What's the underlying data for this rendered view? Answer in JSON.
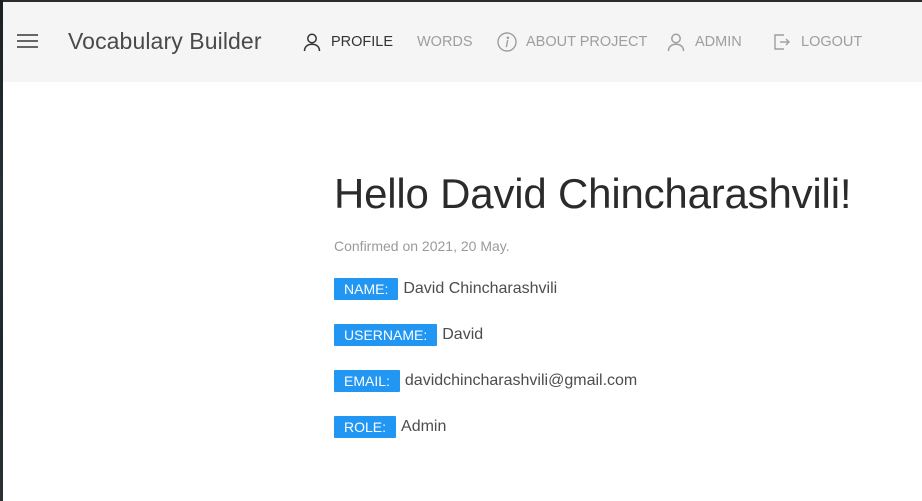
{
  "app": {
    "title": "Vocabulary Builder"
  },
  "nav": {
    "items": [
      {
        "label": "PROFILE",
        "icon": "user-icon",
        "active": true
      },
      {
        "label": "WORDS",
        "icon": "",
        "active": false
      },
      {
        "label": "ABOUT PROJECT",
        "icon": "info-icon",
        "active": false
      },
      {
        "label": "ADMIN",
        "icon": "user-icon",
        "active": false
      },
      {
        "label": "LOGOUT",
        "icon": "logout-icon",
        "active": false
      }
    ]
  },
  "profile": {
    "greeting": "Hello David Chincharashvili!",
    "confirmed": "Confirmed on 2021, 20 May.",
    "fields": [
      {
        "label": "NAME:",
        "value": "David Chincharashvili"
      },
      {
        "label": "USERNAME:",
        "value": "David"
      },
      {
        "label": "EMAIL:",
        "value": "davidchincharashvili@gmail.com"
      },
      {
        "label": "ROLE:",
        "value": "Admin"
      }
    ]
  },
  "colors": {
    "accent": "#2196f3",
    "navbar_bg": "#f5f5f5",
    "nav_text": "#9e9e9e",
    "nav_active_text": "#333333"
  }
}
